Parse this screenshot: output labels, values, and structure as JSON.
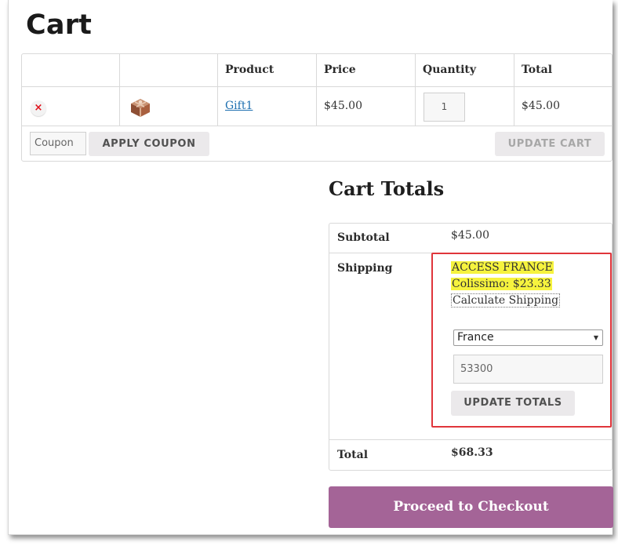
{
  "page": {
    "title": "Cart"
  },
  "cart_table": {
    "columns": [
      "",
      "",
      "Product",
      "Price",
      "Quantity",
      "Total"
    ],
    "rows": [
      {
        "remove_symbol": "×",
        "product_name": "Gift1",
        "price": "$45.00",
        "quantity": "1",
        "total": "$45.00",
        "thumbnail_icon": "gift-box-icon"
      }
    ],
    "coupon_placeholder": "Coupon",
    "apply_coupon_label": "APPLY COUPON",
    "update_cart_label": "UPDATE CART"
  },
  "totals": {
    "title": "Cart Totals",
    "subtotal_label": "Subtotal",
    "subtotal_value": "$45.00",
    "shipping_label": "Shipping",
    "shipping_method_line1": "ACCESS FRANCE",
    "shipping_method_line2": "Colissimo: $23.33",
    "calculate_shipping_label": "Calculate Shipping",
    "country_value": "France",
    "postcode_value": "53300",
    "update_totals_label": "UPDATE TOTALS",
    "total_label": "Total",
    "total_value": "$68.33"
  },
  "checkout": {
    "label": "Proceed to Checkout"
  },
  "colors": {
    "checkout_purple": "#a46497",
    "highlight_yellow": "#f6f33e",
    "annotation_red": "#e0353b",
    "link_blue": "#1e6fb0"
  }
}
